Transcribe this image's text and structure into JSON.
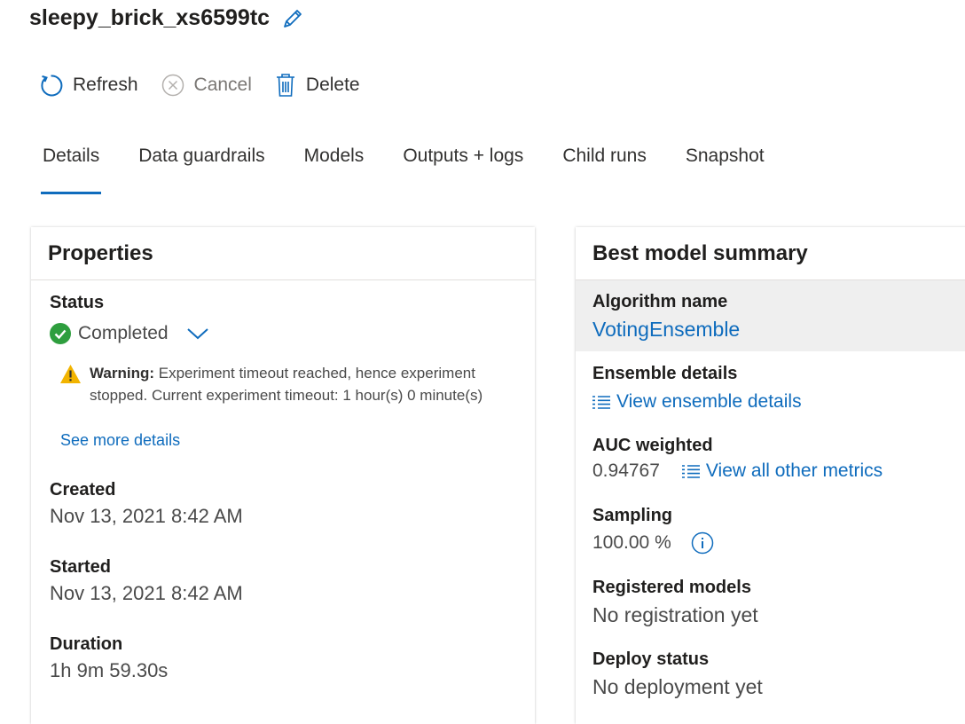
{
  "header": {
    "title": "sleepy_brick_xs6599tc"
  },
  "toolbar": {
    "refresh": "Refresh",
    "cancel": "Cancel",
    "delete": "Delete"
  },
  "tabs": [
    "Details",
    "Data guardrails",
    "Models",
    "Outputs + logs",
    "Child runs",
    "Snapshot"
  ],
  "properties": {
    "heading": "Properties",
    "status_label": "Status",
    "status_value": "Completed",
    "warning_prefix": "Warning:",
    "warning_line1": " Experiment timeout reached, hence experiment",
    "warning_line2": "stopped. Current experiment timeout: 1 hour(s) 0 minute(s)",
    "see_more": "See more details",
    "created_label": "Created",
    "created_value": "Nov 13, 2021 8:42 AM",
    "started_label": "Started",
    "started_value": "Nov 13, 2021 8:42 AM",
    "duration_label": "Duration",
    "duration_value": "1h 9m 59.30s"
  },
  "best_model": {
    "heading": "Best model summary",
    "algorithm_label": "Algorithm name",
    "algorithm_value": "VotingEnsemble",
    "ensemble_label": "Ensemble details",
    "ensemble_link": "View ensemble details",
    "auc_label": "AUC weighted",
    "auc_value": "0.94767",
    "metrics_link": "View all other metrics",
    "sampling_label": "Sampling",
    "sampling_value": "100.00 %",
    "registered_label": "Registered models",
    "registered_value": "No registration yet",
    "deploy_label": "Deploy status",
    "deploy_value": "No deployment yet"
  },
  "colors": {
    "accent": "#0f6cbd",
    "success": "#2e9e3e",
    "warning": "#f2b400"
  },
  "icons": {
    "edit": "pencil-icon",
    "refresh": "refresh-icon",
    "cancel": "cancel-icon",
    "delete": "trash-icon",
    "success": "check-circle-icon",
    "expand": "chevron-down-icon",
    "warning": "warning-icon",
    "list": "list-icon",
    "info": "info-icon"
  }
}
